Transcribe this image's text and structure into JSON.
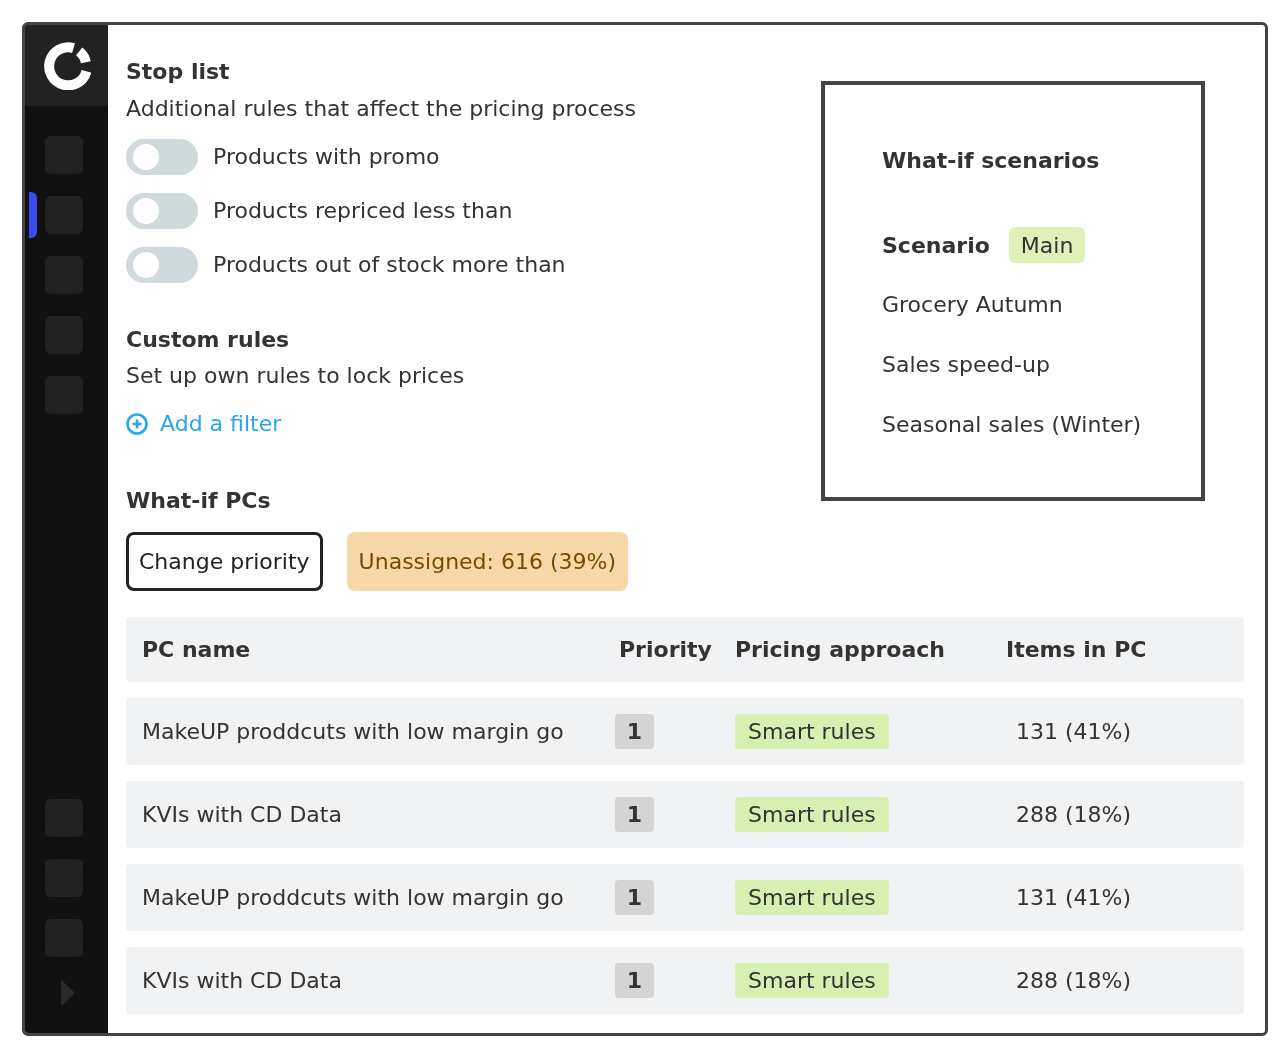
{
  "sidebar": {
    "items": [
      {
        "selected": false
      },
      {
        "selected": true
      },
      {
        "selected": false
      },
      {
        "selected": false
      },
      {
        "selected": false
      }
    ],
    "bottom_items": [
      {
        "selected": false
      },
      {
        "selected": false
      },
      {
        "selected": false
      }
    ]
  },
  "stop_list": {
    "title": "Stop list",
    "subtitle": "Additional rules that affect the pricing process",
    "toggles": [
      {
        "label": "Products with promo",
        "on": false
      },
      {
        "label": "Products repriced less than",
        "on": false
      },
      {
        "label": "Products out of stock more than",
        "on": false
      }
    ]
  },
  "custom_rules": {
    "title": "Custom rules",
    "subtitle": "Set up own rules to lock prices",
    "add_filter": "Add a filter"
  },
  "what_if_pcs": {
    "title": "What-if PCs",
    "change_priority": "Change priority",
    "unassigned": "Unassigned: 616 (39%)"
  },
  "scenarios": {
    "title": "What-if scenarios",
    "label": "Scenario",
    "current": "Main",
    "options": [
      "Grocery Autumn",
      "Sales speed-up",
      "Seasonal sales (Winter)"
    ]
  },
  "table": {
    "columns": [
      "PC name",
      "Priority",
      "Pricing approach",
      "Items in PC"
    ],
    "rows": [
      {
        "pc_name": "MakeUP proddcuts with low margin go",
        "priority": "1",
        "pricing_approach": "Smart rules",
        "items": "131 (41%)"
      },
      {
        "pc_name": "KVIs with CD Data",
        "priority": "1",
        "pricing_approach": "Smart rules",
        "items": "288 (18%)"
      },
      {
        "pc_name": "MakeUP proddcuts with low margin go",
        "priority": "1",
        "pricing_approach": "Smart rules",
        "items": "131 (41%)"
      },
      {
        "pc_name": "KVIs with CD Data",
        "priority": "1",
        "pricing_approach": "Smart rules",
        "items": "288 (18%)"
      }
    ]
  }
}
